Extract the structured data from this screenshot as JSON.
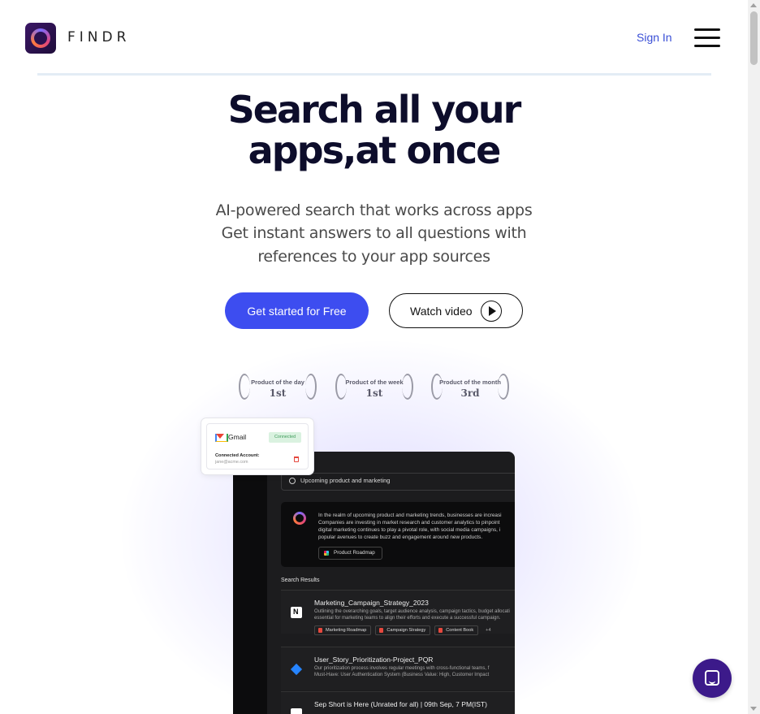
{
  "header": {
    "brand": "FINDR",
    "sign_in": "Sign In"
  },
  "hero": {
    "title_line1": "Search all your",
    "title_line2_prefix": "apps,",
    "title_line2_highlight": " at once",
    "subtitle_line1": "AI-powered search that works across apps",
    "subtitle_line2": "Get instant answers to all questions with",
    "subtitle_line3": "references to your app sources",
    "cta_primary": "Get started for Free",
    "cta_video": "Watch video"
  },
  "badges": [
    {
      "label": "Product of the day",
      "rank": "1st"
    },
    {
      "label": "Product of the week",
      "rank": "1st"
    },
    {
      "label": "Product of the month",
      "rank": "3rd"
    }
  ],
  "mockup": {
    "search_query": "Upcoming product and marketing",
    "ai_answer_lines": [
      "In the realm of upcoming product and marketing trends, businesses are increasi",
      "Companies are investing in market research and customer analytics to pinpoint",
      "digital marketing continues to play a pivotal role, with social media campaigns, i",
      "popular avenues to create buzz and engagement around new products."
    ],
    "ai_chip": "Product Roadmap",
    "results_label": "Search Results",
    "results": [
      {
        "title": "Marketing_Campaign_Strategy_2023",
        "desc_lines": [
          "Outlining the overarching goals, target audience analysis, campaign tactics, budget allocati",
          "essential for marketing teams to align their efforts and execute a successful campaign."
        ],
        "tags": [
          "Marketing Roadmap",
          "Campaign Strategy",
          "Content Book"
        ],
        "more": "+4"
      },
      {
        "title": "User_Story_Prioritization-Project_PQR",
        "desc_lines": [
          "Our prioritization process involves regular meetings with cross-functional teams, f",
          "Must-Have: User Authentication System (Business Value: High, Customer Impact"
        ]
      },
      {
        "title": "Sep Short is Here (Unrated for all) | 09th Sep, 7 PM(IST)",
        "desc_lines": [
          "",
          ""
        ]
      }
    ]
  },
  "gmail_card": {
    "app": "Gmail",
    "status": "Connected",
    "account_label": "Connected Account:",
    "account_email": "jane@acme.com"
  },
  "colors": {
    "primary": "#3d4df0",
    "title": "#0d0d2b",
    "highlight": "#9ea4ff",
    "chat": "#3c1a8a"
  }
}
